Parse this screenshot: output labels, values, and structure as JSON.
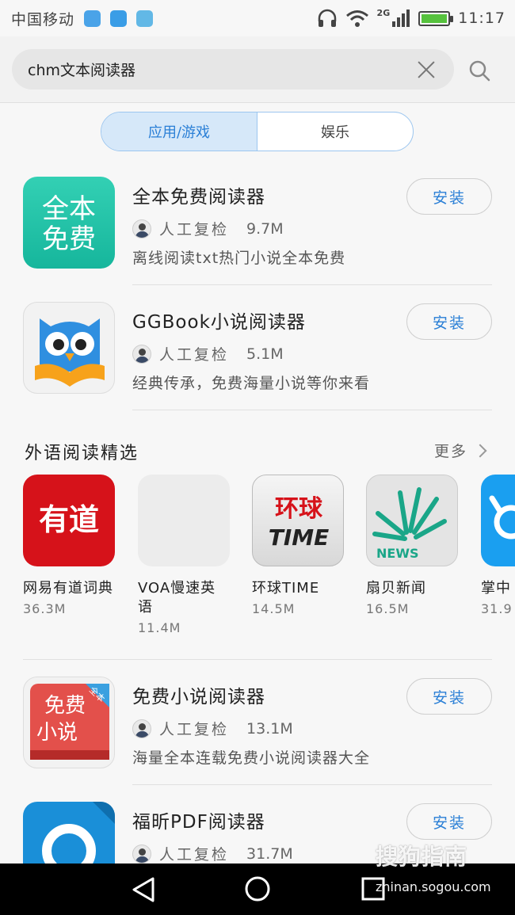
{
  "status_bar": {
    "carrier": "中国移动",
    "network": "2G",
    "time": "11:17"
  },
  "search": {
    "query": "chm文本阅读器"
  },
  "tabs": [
    {
      "label": "应用/游戏",
      "active": true
    },
    {
      "label": "娱乐",
      "active": false
    }
  ],
  "apps": [
    {
      "name": "全本免费阅读器",
      "reviewer": "人工复检",
      "size": "9.7M",
      "desc": "离线阅读txt热门小说全本免费",
      "install": "安装",
      "icon_text": [
        "全本",
        "免费"
      ]
    },
    {
      "name": "GGBook小说阅读器",
      "reviewer": "人工复检",
      "size": "5.1M",
      "desc": "经典传承，免费海量小说等你来看",
      "install": "安装"
    },
    {
      "name": "免费小说阅读器",
      "reviewer": "人工复检",
      "size": "13.1M",
      "desc": "海量全本连载免费小说阅读器大全",
      "install": "安装",
      "icon_text": [
        "免费",
        "小说",
        "全本"
      ]
    },
    {
      "name": "福昕PDF阅读器",
      "reviewer": "人工复检",
      "size": "31.7M",
      "install": "安装"
    }
  ],
  "section": {
    "title": "外语阅读精选",
    "more": "更多",
    "items": [
      {
        "name": "网易有道词典",
        "size": "36.3M",
        "icon_text": "有道"
      },
      {
        "name": "VOA慢速英语",
        "size": "11.4M"
      },
      {
        "name": "环球TIME",
        "size": "14.5M",
        "icon_text": [
          "环球",
          "TIME"
        ]
      },
      {
        "name": "扇贝新闻",
        "size": "16.5M",
        "icon_text": "NEWS"
      },
      {
        "name": "掌中",
        "size": "31.9"
      }
    ]
  },
  "watermark": {
    "brand": "搜狗指南",
    "url": "zhinan.sogou.com"
  },
  "colors": {
    "accent": "#2a7fd6",
    "battery": "#56c23d"
  }
}
